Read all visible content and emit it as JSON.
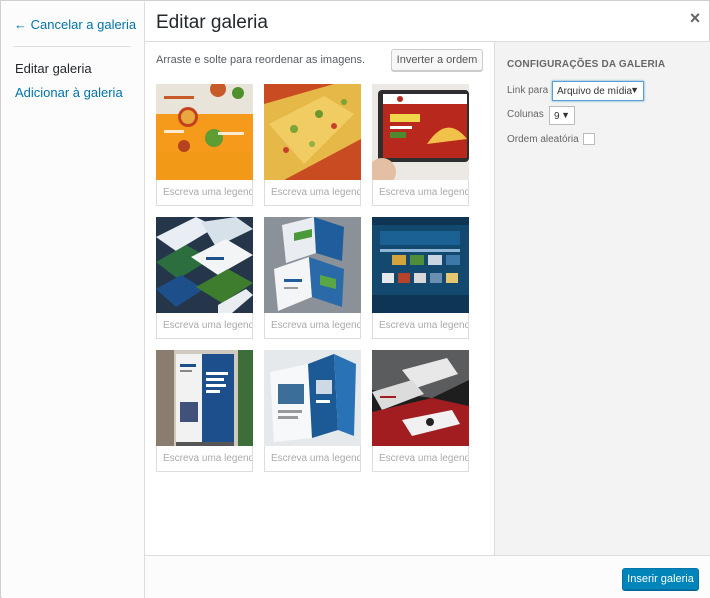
{
  "sidebar": {
    "cancel_arrow": "←",
    "cancel_label": "Cancelar a galeria",
    "items": [
      {
        "label": "Editar galeria"
      },
      {
        "label": "Adicionar à galeria"
      }
    ]
  },
  "header": {
    "title": "Editar galeria",
    "close_glyph": "×"
  },
  "toolbar": {
    "hint": "Arraste e solte para reordenar as imagens.",
    "reverse_label": "Inverter a ordem"
  },
  "gallery": {
    "caption_placeholder": "Escreva uma legenda...",
    "images": [
      {
        "icon": "pizza-site-image"
      },
      {
        "icon": "pizza-closeup-image"
      },
      {
        "icon": "tablet-pizza-site-image"
      },
      {
        "icon": "brochures-flatlay-image"
      },
      {
        "icon": "trifold-brochure-image"
      },
      {
        "icon": "blue-website-image"
      },
      {
        "icon": "rollup-banner-image"
      },
      {
        "icon": "blue-folder-image"
      },
      {
        "icon": "dark-stationery-image"
      }
    ]
  },
  "settings": {
    "title": "CONFIGURAÇÕES DA GALERIA",
    "link_label": "Link para",
    "link_value": "Arquivo de mídia",
    "columns_label": "Colunas",
    "columns_value": "9",
    "random_label": "Ordem aleatória",
    "random_checked": false
  },
  "footer": {
    "insert_label": "Inserir galeria"
  },
  "colors": {
    "link": "#0073aa",
    "primary": "#0085ba"
  }
}
